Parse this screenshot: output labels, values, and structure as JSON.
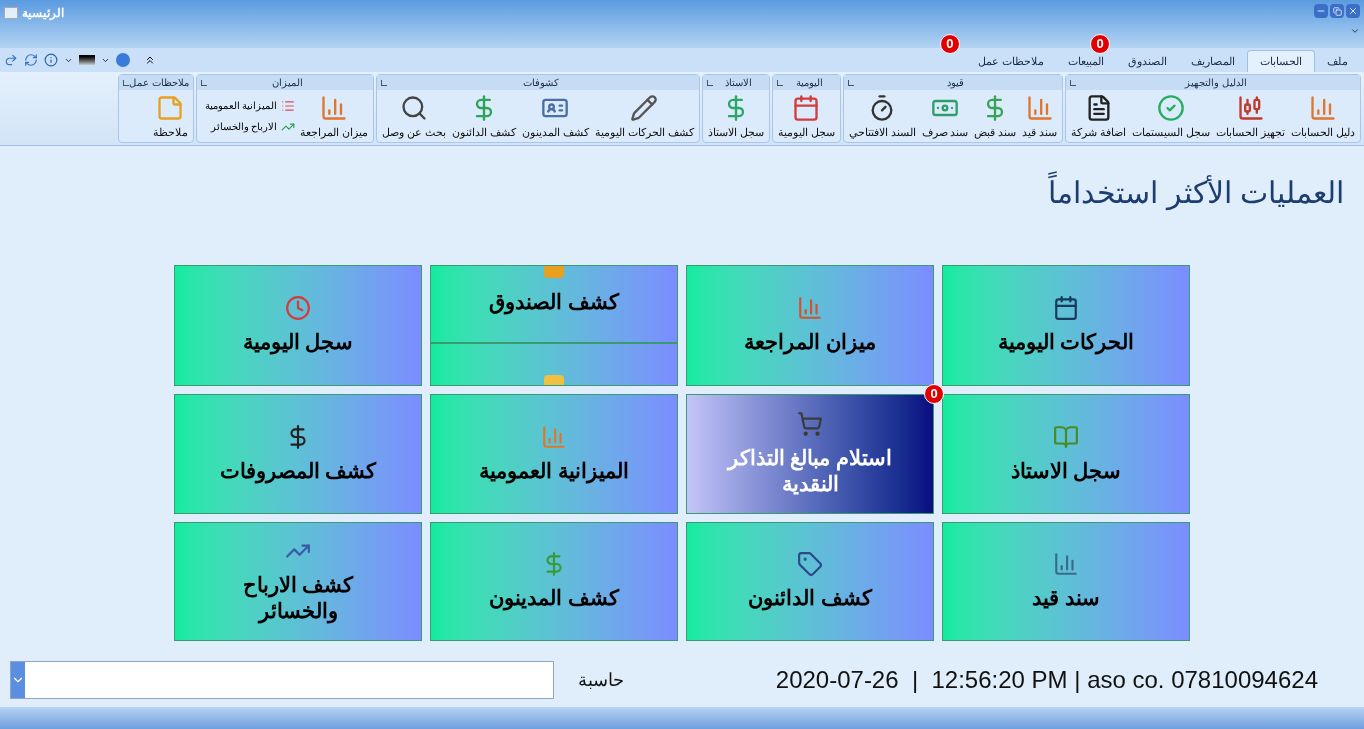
{
  "window": {
    "title": "الرئيسية"
  },
  "tabs": [
    {
      "label": "ملف",
      "selected": false
    },
    {
      "label": "الحسابات",
      "selected": true
    },
    {
      "label": "المصاريف",
      "selected": false
    },
    {
      "label": "الصندوق",
      "selected": false,
      "badge": "0"
    },
    {
      "label": "المبيعات",
      "selected": false
    },
    {
      "label": "ملاحظات عمل",
      "selected": false,
      "badge": "0"
    }
  ],
  "ribbon_groups": [
    {
      "title": "الدليل والتجهيز",
      "items": [
        {
          "label": "دليل الحسابات"
        },
        {
          "label": "تجهيز الحسابات"
        },
        {
          "label": "سجل السيستمات"
        },
        {
          "label": "اضافة شركة"
        }
      ]
    },
    {
      "title": "قيود",
      "items": [
        {
          "label": "سند قيد"
        },
        {
          "label": "سند قبض"
        },
        {
          "label": "سند صرف"
        },
        {
          "label": "السند الافتتاحي"
        }
      ]
    },
    {
      "title": "اليومية",
      "items": [
        {
          "label": "سجل اليومية"
        }
      ]
    },
    {
      "title": "الاستاذ",
      "items": [
        {
          "label": "سجل الاستاذ"
        }
      ]
    },
    {
      "title": "كشوفات",
      "items": [
        {
          "label": "كشف الحركات اليومية"
        },
        {
          "label": "كشف المدينون"
        },
        {
          "label": "كشف الدائنون"
        },
        {
          "label": "بحث عن وصل"
        }
      ]
    },
    {
      "title": "الميزان",
      "items": [
        {
          "label": "ميزان المراجعة"
        }
      ],
      "small_items": [
        {
          "label": "الميزانية العمومية"
        },
        {
          "label": "الارباح والخسائر"
        }
      ]
    },
    {
      "title": "ملاحظات عمل",
      "items": [
        {
          "label": "ملاحظة"
        }
      ]
    }
  ],
  "heading": "العمليات الأكثر استخداماً",
  "tiles": [
    {
      "label": "الحركات اليومية",
      "selected": false,
      "kind": "normal"
    },
    {
      "label": "ميزان المراجعة",
      "selected": false,
      "kind": "normal"
    },
    {
      "label": "كشف الصندوق",
      "selected": false,
      "kind": "sliding"
    },
    {
      "label": "سجل اليومية",
      "selected": false,
      "kind": "normal"
    },
    {
      "label": "سجل الاستاذ",
      "selected": false,
      "kind": "normal"
    },
    {
      "label": "استلام مبالغ التذاكر النقدية",
      "selected": true,
      "kind": "normal",
      "badge": "0"
    },
    {
      "label": "الميزانية العمومية",
      "selected": false,
      "kind": "normal"
    },
    {
      "label": "كشف المصروفات",
      "selected": false,
      "kind": "normal"
    },
    {
      "label": "سند قيد",
      "selected": false,
      "kind": "normal"
    },
    {
      "label": "كشف الدائنون",
      "selected": false,
      "kind": "normal"
    },
    {
      "label": "كشف المدينون",
      "selected": false,
      "kind": "normal"
    },
    {
      "label": "كشف الارباح والخسائر",
      "selected": false,
      "kind": "normal"
    }
  ],
  "calculator": {
    "label": "حاسبة"
  },
  "status": "2020-07-26  |  12:56:20 PM | aso co. 07810094624"
}
